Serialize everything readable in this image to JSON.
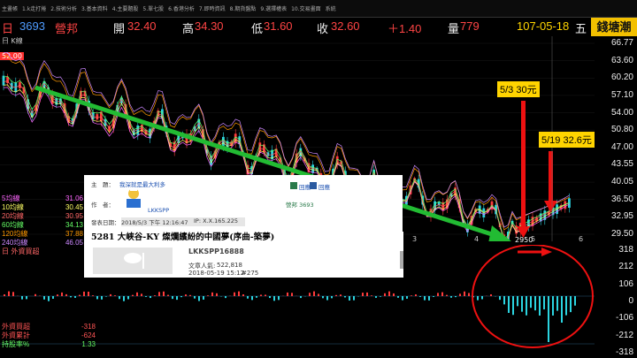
{
  "menu": [
    "主畫帳",
    "1.k走打捲",
    "2.技術分析",
    "3.基本資料",
    "4.主要題股",
    "5.單七股",
    "6.香港分析",
    "7.即時資訊",
    "8.期貨盤點",
    "9.選擇權表",
    "10.交易畫面",
    "系統"
  ],
  "quote": {
    "period": "日",
    "code": "3693",
    "name": "營邦",
    "open_label": "開",
    "open": "32.40",
    "high_label": "高",
    "high": "34.30",
    "low_label": "低",
    "low": "31.60",
    "close_label": "收",
    "close": "32.60",
    "change": "＋1.40",
    "volume_label": "量",
    "volume": "779",
    "date": "107-05-18",
    "weekday": "五",
    "brand": "錢塘潮"
  },
  "main_panel": {
    "title": "日 K線",
    "price_flag": "52.00",
    "axis": [
      "66.77",
      "63.60",
      "60.20",
      "57.10",
      "54.00",
      "50.80",
      "47.00",
      "43.55",
      "40.05",
      "36.50",
      "32.95",
      "29.50"
    ],
    "low_marker": "2950",
    "x_labels": [
      "3",
      "4",
      "5",
      "6"
    ],
    "ma": [
      {
        "label": "5均線",
        "value": "31.06",
        "color": "#ff66ff"
      },
      {
        "label": "10均線",
        "value": "30.45",
        "color": "#ffff66"
      },
      {
        "label": "20均線",
        "value": "30.95",
        "color": "#ff6666"
      },
      {
        "label": "60均線",
        "value": "34.13",
        "color": "#66ff66"
      },
      {
        "label": "120均線",
        "value": "37.88",
        "color": "#ff9900"
      },
      {
        "label": "240均線",
        "value": "46.05",
        "color": "#cc88ff"
      }
    ],
    "label_a": "5/3 30元",
    "label_b": "5/19 32.6元"
  },
  "forum": {
    "subject_label": "主　題：",
    "subject": "我深就是最大利多",
    "author_label": "作　者：",
    "author": "LKKSPP",
    "date_label": "發表日期：",
    "date": "2018/5/3 下午 12:16:47",
    "ip": "IP: X.X.165.225",
    "board": "營邦 3693",
    "action1": "回應",
    "action2": "回應"
  },
  "headline": "5281 大峽谷-KY 燦爛繽紛的中國夢(序曲-築夢)",
  "post": {
    "user": "LKKSPP16888",
    "views_label": "文章人氣:",
    "views": "522,818",
    "date": "2018-05-19 15:12",
    "num": "#275"
  },
  "lower_panel": {
    "title": "日 外資買超",
    "axis": [
      "318",
      "212",
      "106",
      "0",
      "-106",
      "-212",
      "-318"
    ],
    "stats": [
      {
        "label": "外資買超",
        "value": "-318"
      },
      {
        "label": "外資累計",
        "value": "-624"
      },
      {
        "label": "持股率%",
        "value": "1.33"
      }
    ]
  }
}
